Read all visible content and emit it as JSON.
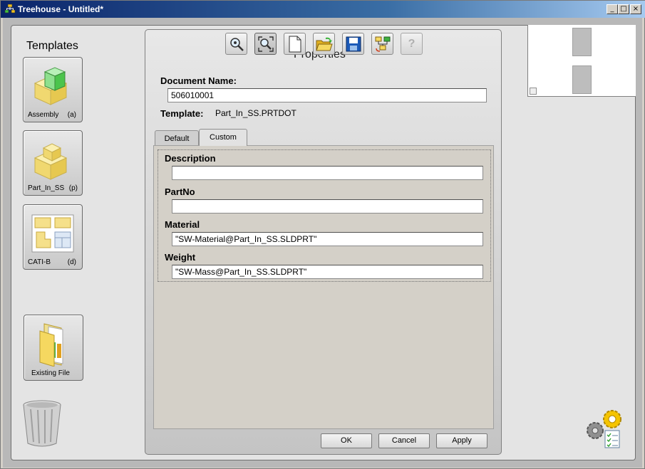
{
  "window": {
    "title": "Treehouse - Untitled*",
    "controls": [
      "_",
      "□",
      "×"
    ]
  },
  "templates": {
    "heading": "Templates",
    "items": [
      {
        "label": "Assembly",
        "key": "(a)",
        "icon": "assembly-icon"
      },
      {
        "label": "Part_In_SS",
        "key": "(p)",
        "icon": "part-icon"
      },
      {
        "label": "CATI-B",
        "key": "(d)",
        "icon": "drawing-icon"
      }
    ],
    "existing_file": {
      "label": "Existing File",
      "icon": "folder-icon"
    }
  },
  "toolbar": {
    "buttons": [
      {
        "icon": "zoom-icon"
      },
      {
        "icon": "zoom-fit-icon"
      },
      {
        "icon": "new-document-icon"
      },
      {
        "icon": "open-folder-icon"
      },
      {
        "icon": "save-icon"
      },
      {
        "icon": "refresh-icon"
      },
      {
        "icon": "help-icon",
        "glyph": "?"
      }
    ]
  },
  "properties": {
    "title": "Properties",
    "document_name_label": "Document Name:",
    "document_name_value": "506010001",
    "template_label": "Template:",
    "template_value": "Part_In_SS.PRTDOT",
    "tabs": [
      {
        "label": "Default",
        "active": false
      },
      {
        "label": "Custom",
        "active": true
      }
    ],
    "fields": [
      {
        "label": "Description",
        "value": ""
      },
      {
        "label": "PartNo",
        "value": ""
      },
      {
        "label": "Material",
        "value": "\"SW-Material@Part_In_SS.SLDPRT\""
      },
      {
        "label": "Weight",
        "value": "\"SW-Mass@Part_In_SS.SLDPRT\""
      }
    ],
    "buttons": {
      "ok": "OK",
      "cancel": "Cancel",
      "apply": "Apply"
    }
  },
  "icons": {
    "trash": "trash-icon",
    "settings": "settings-gear-icon"
  },
  "colors": {
    "titlebar_start": "#0a246a",
    "titlebar_end": "#a6caf0",
    "accent_yellow": "#f5e08a",
    "accent_green": "#6fcf6f"
  }
}
